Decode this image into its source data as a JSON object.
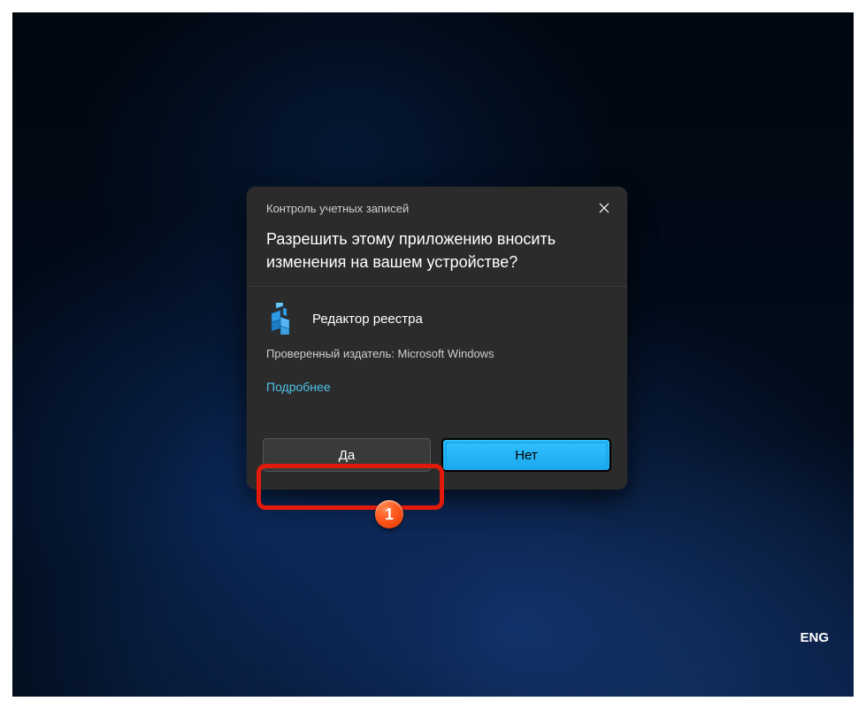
{
  "dialog": {
    "title": "Контроль учетных записей",
    "question": "Разрешить этому приложению вносить изменения на вашем устройстве?",
    "app_name": "Редактор реестра",
    "publisher_line": "Проверенный издатель: Microsoft Windows",
    "more_link": "Подробнее",
    "yes_label": "Да",
    "no_label": "Нет"
  },
  "system": {
    "language_indicator": "ENG"
  },
  "annotation": {
    "step_number": "1"
  }
}
